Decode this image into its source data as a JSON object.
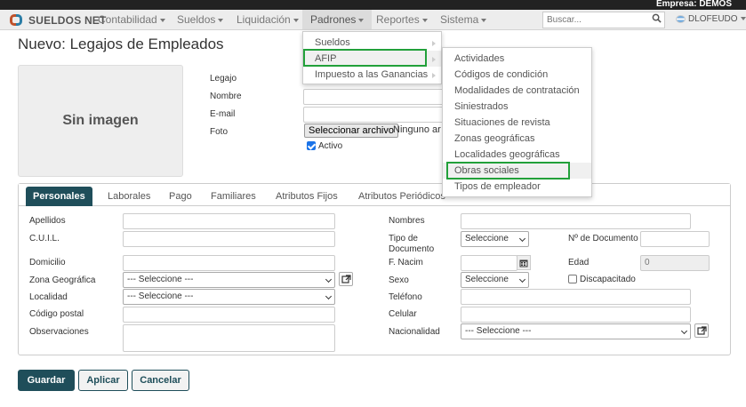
{
  "top_bar": {
    "empresa": "Empresa: DEMOS"
  },
  "navbar": {
    "brand": "SUELDOS NET",
    "menus": [
      "Contabilidad",
      "Sueldos",
      "Liquidación",
      "Padrones",
      "Reportes",
      "Sistema"
    ],
    "search_placeholder": "Buscar...",
    "user": "DLOFEUDO"
  },
  "page": {
    "title": "Nuevo: Legajos de Empleados",
    "no_image": "Sin imagen"
  },
  "header_form": {
    "legajo_label": "Legajo",
    "nombre_label": "Nombre",
    "email_label": "E-mail",
    "foto_label": "Foto",
    "file_button": "Seleccionar archivo",
    "file_status": "Ninguno ar",
    "activo_label": "Activo",
    "activo_checked": true
  },
  "tabs": [
    "Personales",
    "Laborales",
    "Pago",
    "Familiares",
    "Atributos Fijos",
    "Atributos Periódicos"
  ],
  "personales": {
    "apellidos": "Apellidos",
    "cuil": "C.U.I.L.",
    "domicilio": "Domicilio",
    "zona_geografica": "Zona Geográfica",
    "zona_value": "--- Seleccione ---",
    "localidad": "Localidad",
    "localidad_value": "--- Seleccione ---",
    "codigo_postal": "Código postal",
    "observaciones": "Observaciones",
    "nombres": "Nombres",
    "tipo_documento": "Tipo de Documento",
    "tipo_documento_value": "Seleccione",
    "nro_documento": "Nº de Documento",
    "f_nacim": "F. Nacim",
    "edad": "Edad",
    "edad_value": "0",
    "sexo": "Sexo",
    "sexo_value": "Seleccione",
    "discapacitado": "Discapacitado",
    "telefono": "Teléfono",
    "celular": "Celular",
    "nacionalidad": "Nacionalidad",
    "nacionalidad_value": "--- Seleccione ---"
  },
  "actions": {
    "save": "Guardar",
    "apply": "Aplicar",
    "cancel": "Cancelar"
  },
  "padrones_menu": [
    "Sueldos",
    "AFIP",
    "Impuesto a las Ganancias"
  ],
  "afip_menu": [
    "Actividades",
    "Códigos de condición",
    "Modalidades de contratación",
    "Siniestrados",
    "Situaciones de revista",
    "Zonas geográficas",
    "Localidades geográficas",
    "Obras sociales",
    "Tipos de empleador"
  ],
  "colors": {
    "primary": "#1f4e5a",
    "highlight_box": "#22a03a"
  }
}
